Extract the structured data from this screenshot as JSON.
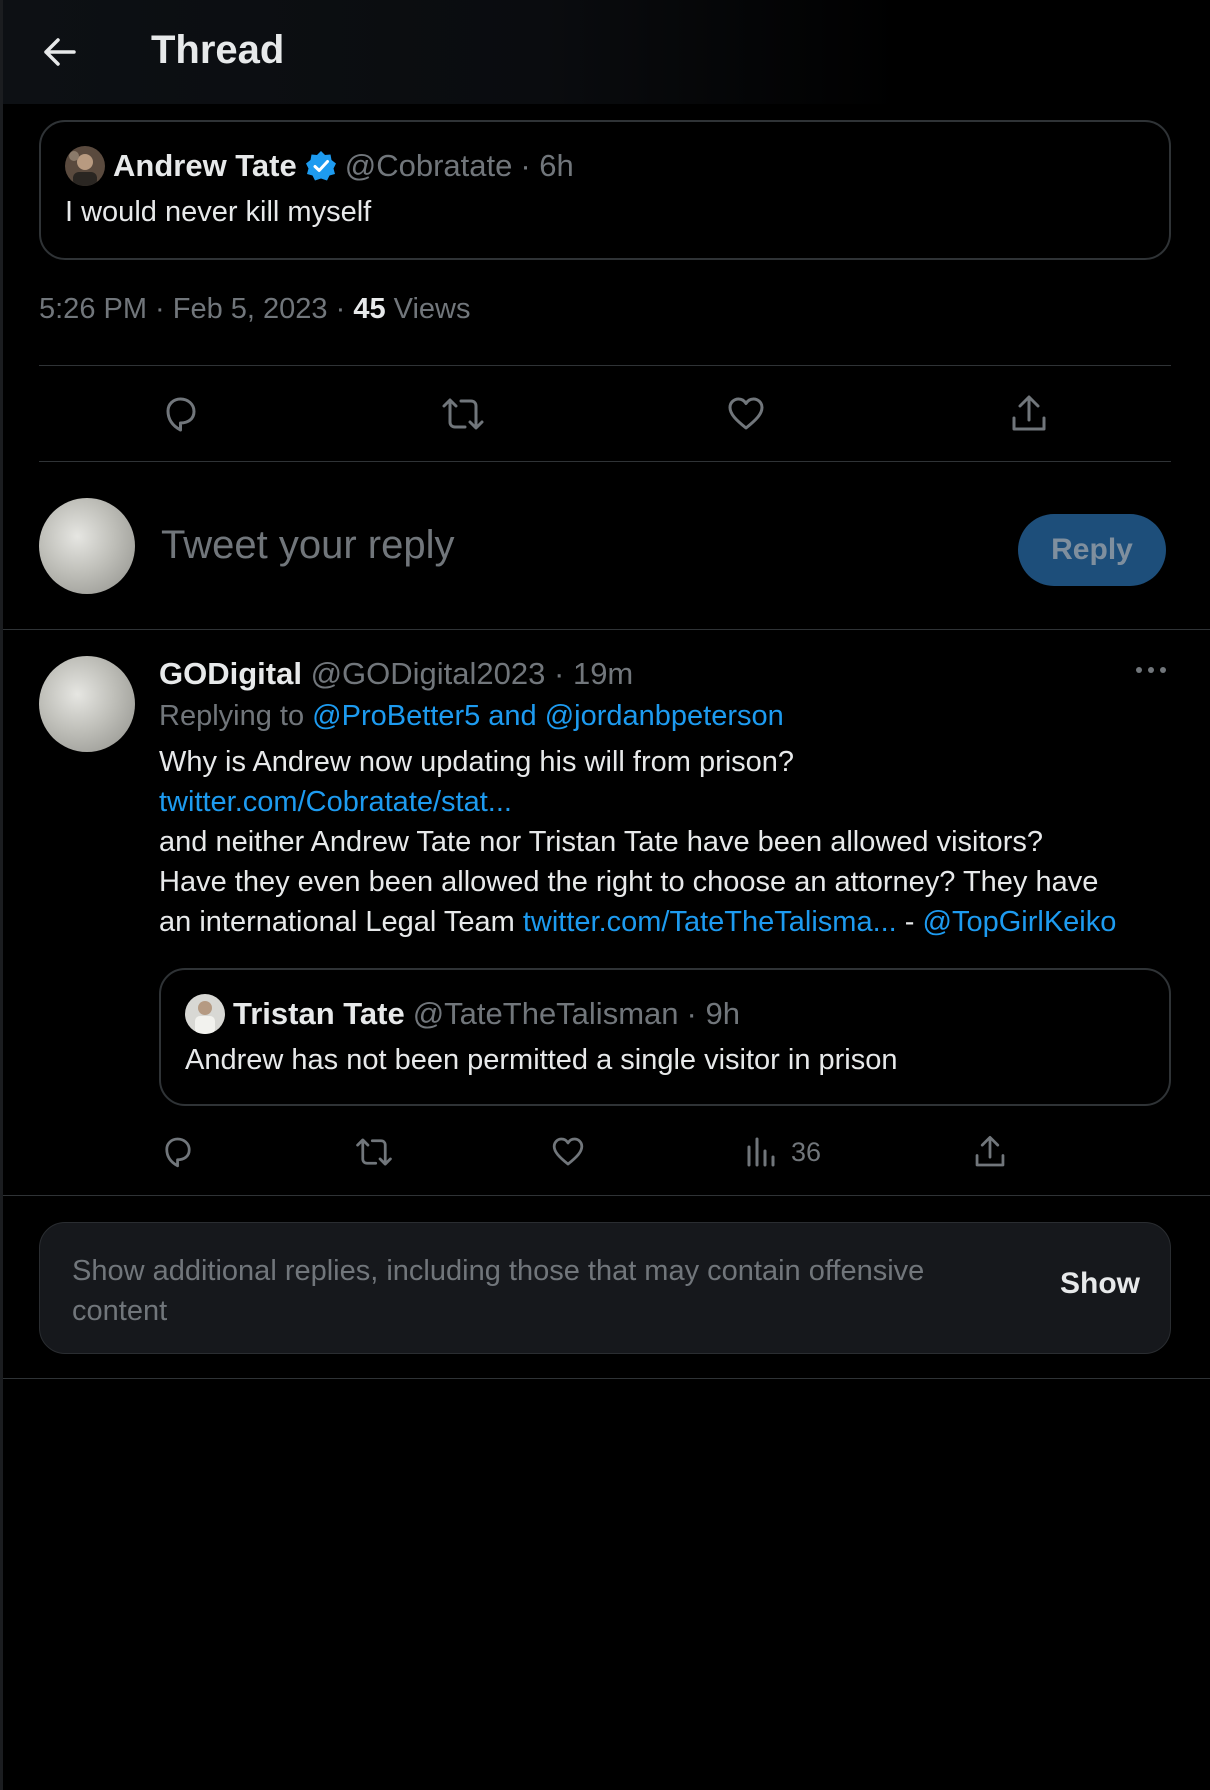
{
  "header": {
    "title": "Thread"
  },
  "quoted_tweet_top": {
    "name": "Andrew Tate",
    "handle": "@Cobratate",
    "time": "· 6h",
    "text": "I would never kill myself"
  },
  "tweet_meta": {
    "timestamp": "5:26 PM · Feb 5, 2023 · ",
    "views_count": "45",
    "views_label": " Views"
  },
  "reply_box": {
    "placeholder": "Tweet your reply",
    "button_label": "Reply"
  },
  "reply_tweet": {
    "name": "GODigital",
    "handle": "@GODigital2023",
    "time": "· 19m",
    "replying_prefix": "Replying to ",
    "replying_users": "@ProBetter5 and @jordanbpeterson",
    "body_line1": "Why is Andrew now updating his will from prison?",
    "body_link1": "twitter.com/Cobratate/stat...",
    "body_line3": "and neither Andrew Tate nor Tristan Tate have been allowed visitors?",
    "body_line4": "Have they even been allowed the right to choose an attorney? They have",
    "body_line5_text": "an international Legal Team ",
    "body_link2": "twitter.com/TateTheTalisma...",
    "body_dash": " - ",
    "body_mention": "@TopGirlKeiko",
    "quoted": {
      "name": "Tristan Tate",
      "handle": "@TateTheTalisman",
      "time": "· 9h",
      "text": "Andrew has not been permitted a single visitor in prison"
    },
    "views_count": "36"
  },
  "additional_replies": {
    "text": "Show additional replies, including those that may contain offensive content",
    "button_label": "Show"
  },
  "colors": {
    "background": "#000000",
    "accent": "#1d9bf0",
    "muted": "#71767b",
    "text": "#e7e9ea",
    "border": "#2f3336"
  }
}
